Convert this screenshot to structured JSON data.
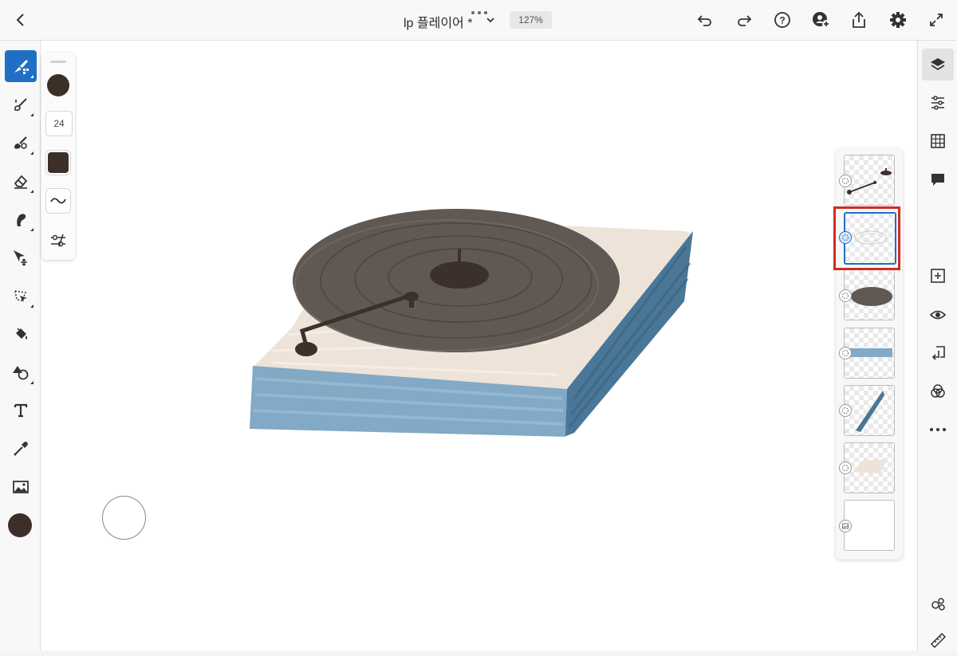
{
  "header": {
    "doc_title": "lp 플레이어 *",
    "zoom": "127%",
    "icons": [
      "back-icon",
      "title-chevron-down-icon",
      "undo-icon",
      "redo-icon",
      "help-icon",
      "invite-user-icon",
      "share-icon",
      "settings-icon",
      "fullscreen-icon"
    ]
  },
  "left_toolbar": {
    "tools": [
      "brush-stack-icon",
      "watercolor-brush-icon",
      "oil-brush-icon",
      "eraser-icon",
      "smudge-icon",
      "move-icon",
      "lasso-icon",
      "fill-icon",
      "shape-icon",
      "text-icon",
      "eyedropper-icon",
      "image-icon",
      "color-swatch-icon"
    ],
    "current_color": "#3b2f28"
  },
  "brush_panel": {
    "size": "24",
    "color": "#3b2f28"
  },
  "right_toolbar": {
    "tools": [
      "layers-icon",
      "adjustments-icon",
      "grid-icon",
      "comments-icon",
      "add-layer-icon",
      "visibility-icon",
      "merge-down-icon",
      "blend-mode-icon",
      "more-options-icon",
      "livestream-icon",
      "ruler-icon"
    ]
  },
  "layers": {
    "count": 7,
    "selected_index": 1,
    "thumbnails": [
      "tonearm-layer",
      "selected-sketch-layer",
      "record-layer",
      "front-blue-layer",
      "side-blue-layer",
      "top-beige-layer",
      "background-layer"
    ]
  },
  "colors": {
    "accent": "#1f6fc5",
    "highlight": "#d12b21",
    "record": "#5d5651",
    "base_blue": "#7fa7c4",
    "base_side_blue": "#3f6f92",
    "base_top": "#ede3d8"
  }
}
